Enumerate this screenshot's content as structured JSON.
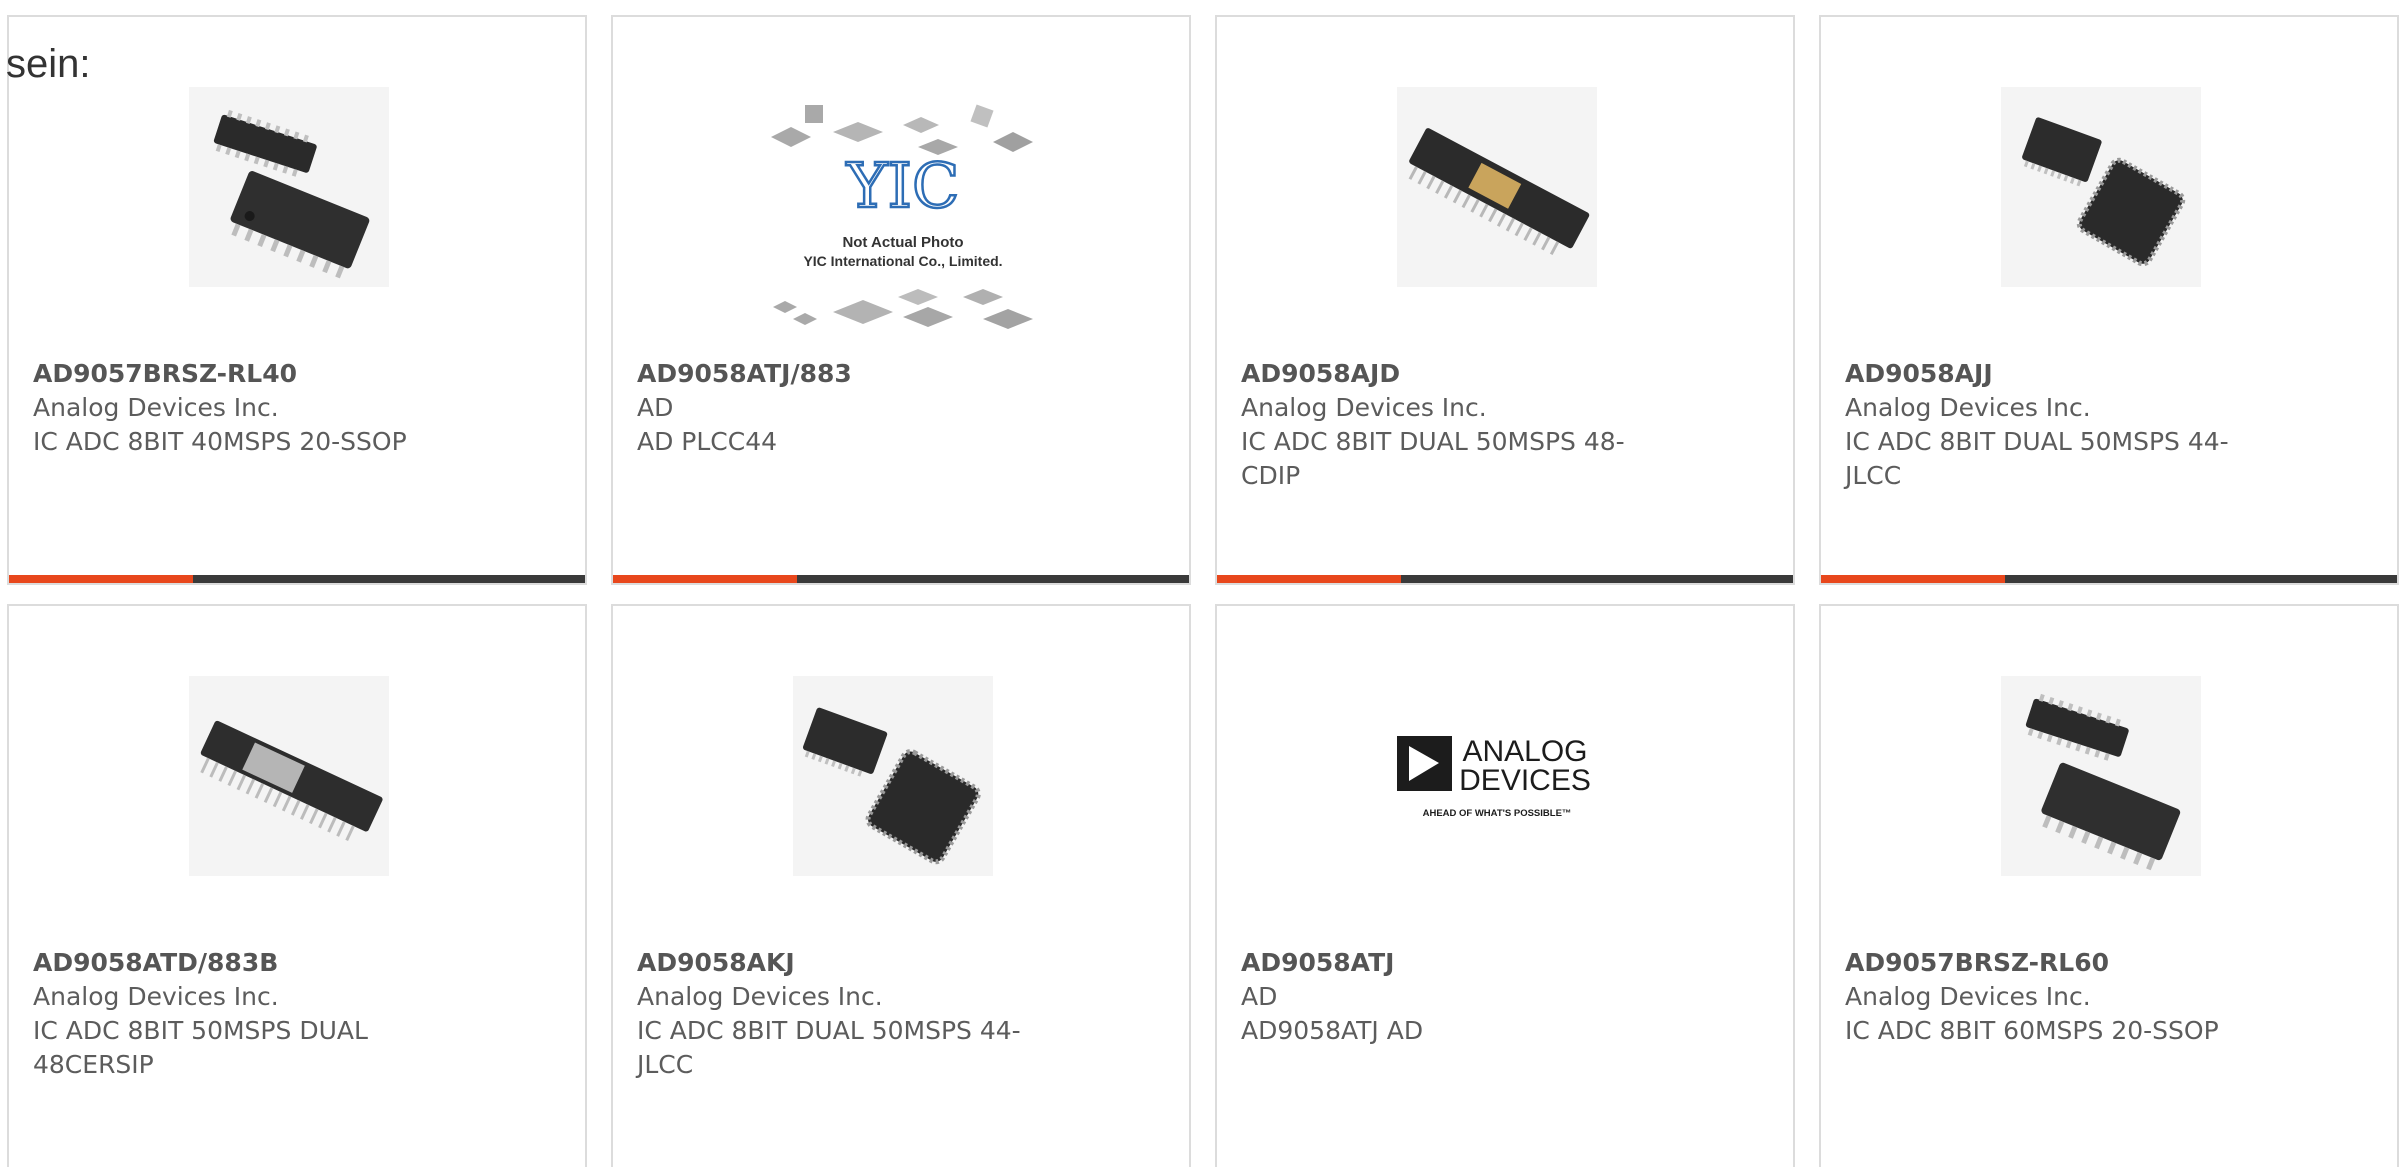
{
  "lead_text": "sein:",
  "colors": {
    "accent": "#e8471c",
    "bar": "#3a3a3a",
    "border": "#dcdcdc"
  },
  "products": [
    {
      "part_number": "AD9057BRSZ-RL40",
      "manufacturer": "Analog Devices Inc.",
      "description": "IC ADC 8BIT 40MSPS 20-SSOP",
      "image": "ssop-chip-photo"
    },
    {
      "part_number": "AD9058ATJ/883",
      "manufacturer": "AD",
      "description": "AD PLCC44",
      "image": "placeholder-not-actual-photo",
      "image_logo": "YIC",
      "image_caption_1": "Not Actual Photo",
      "image_caption_2": "YIC International Co., Limited."
    },
    {
      "part_number": "AD9058AJD",
      "manufacturer": "Analog Devices Inc.",
      "description": "IC ADC 8BIT DUAL 50MSPS 48-CDIP",
      "image": "cdip-chip-photo"
    },
    {
      "part_number": "AD9058AJJ",
      "manufacturer": "Analog Devices Inc.",
      "description": "IC ADC 8BIT DUAL 50MSPS 44-JLCC",
      "image": "jlcc-chip-photo"
    },
    {
      "part_number": "AD9058ATD/883B",
      "manufacturer": "Analog Devices Inc.",
      "description": "IC ADC 8BIT 50MSPS DUAL 48CERSIP",
      "image": "sip-chip-photo"
    },
    {
      "part_number": "AD9058AKJ",
      "manufacturer": "Analog Devices Inc.",
      "description": "IC ADC 8BIT DUAL 50MSPS 44-JLCC",
      "image": "jlcc-chip-photo"
    },
    {
      "part_number": "AD9058ATJ",
      "manufacturer": "AD",
      "description": "AD9058ATJ AD",
      "image": "analog-devices-logo",
      "image_logo_1": "ANALOG",
      "image_logo_2": "DEVICES",
      "image_tagline": "AHEAD OF WHAT'S POSSIBLE™"
    },
    {
      "part_number": "AD9057BRSZ-RL60",
      "manufacturer": "Analog Devices Inc.",
      "description": "IC ADC 8BIT 60MSPS 20-SSOP",
      "image": "ssop-chip-photo"
    }
  ]
}
